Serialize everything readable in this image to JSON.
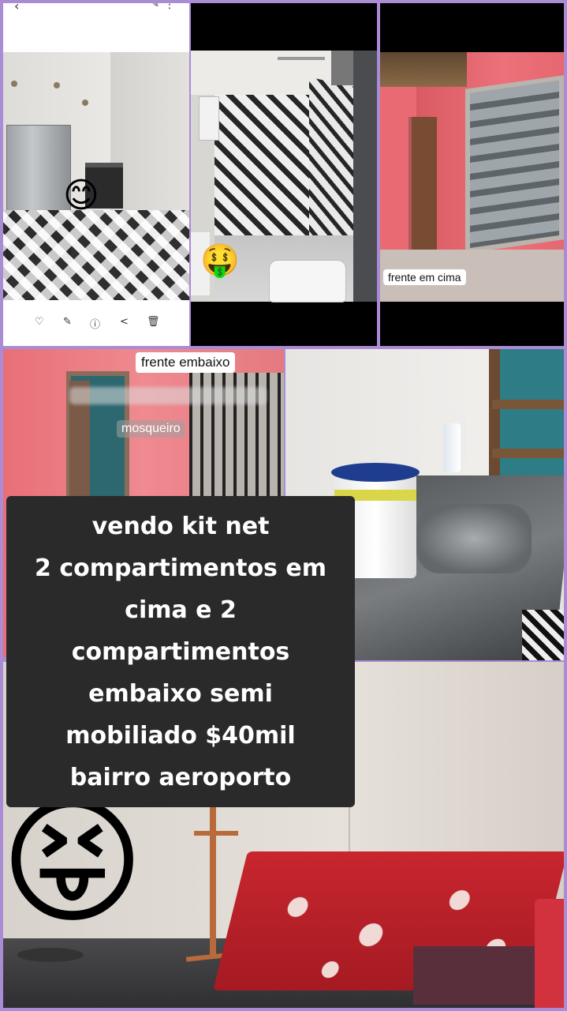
{
  "labels": {
    "frente_em_cima": "frente em cima",
    "frente_embaixo": "frente embaixo",
    "mosqueiro": "mosqueiro"
  },
  "caption": {
    "lines": [
      "vendo kit net",
      "2 compartimentos em",
      "cima e 2",
      "compartimentos",
      "embaixo semi",
      "mobiliado $40mil",
      "bairro aeroporto"
    ]
  },
  "emojis": {
    "smiling": "😊",
    "money_mouth": "🤑",
    "squinting_tongue": "😝"
  },
  "gallery_ui": {
    "back": "‹",
    "more": "⋮",
    "edit": "✎",
    "actions": [
      "♡",
      "✎",
      "ⓘ",
      "<",
      "🗑"
    ]
  },
  "colors": {
    "frame_border": "#a98bd6",
    "caption_bg": "#2a2a2a",
    "caption_text": "#ffffff",
    "label_bg": "#ffffff"
  }
}
